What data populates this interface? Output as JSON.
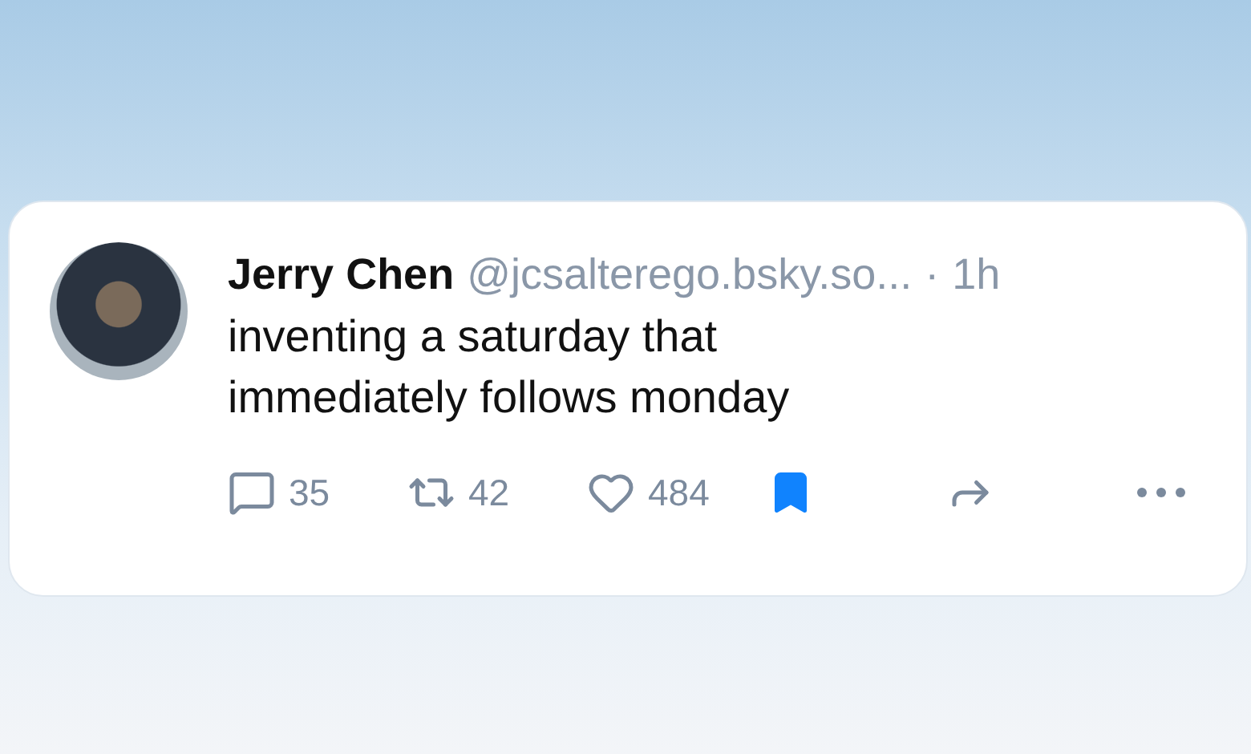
{
  "post": {
    "author": "Jerry Chen",
    "handle": "@jcsalterego.bsky.so...",
    "separator": "·",
    "time": "1h",
    "text": "inventing a saturday that immediately follows monday",
    "actions": [
      {
        "kind": "reply",
        "count": "35"
      },
      {
        "kind": "repost",
        "count": "42"
      },
      {
        "kind": "like",
        "count": "484"
      },
      {
        "kind": "bookmark",
        "saved": true
      },
      {
        "kind": "share"
      },
      {
        "kind": "more"
      }
    ]
  }
}
